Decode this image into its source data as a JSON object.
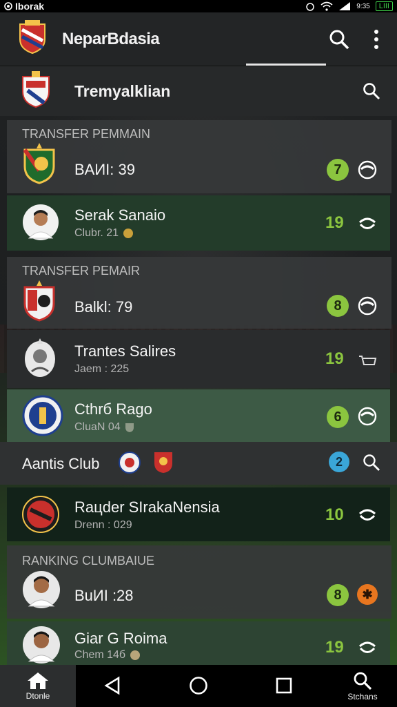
{
  "status_bar": {
    "carrier": "Iborak",
    "battery": "LIII",
    "time_glyph": "9:35"
  },
  "app_bar": {
    "title": "NeparBdasia"
  },
  "sub_bar": {
    "title": "Tremyalklian"
  },
  "sections": [
    {
      "label": "TRANSFER PEMMAIN"
    },
    {
      "label": "TRANSFER PEMAIR"
    },
    {
      "label": "RANKING CLUMBAIUE"
    }
  ],
  "rows": [
    {
      "name": "BAИI: 39",
      "sub": "",
      "value": "7",
      "value_style": "badge"
    },
    {
      "name": "Serak Sanaio",
      "sub": "Clubr. 21",
      "value": "19",
      "value_style": "score"
    },
    {
      "name": "Balkl: 79",
      "sub": "",
      "value": "8",
      "value_style": "badge"
    },
    {
      "name": "Trantes Salires",
      "sub": "Jaem : 225",
      "value": "19",
      "value_style": "score"
    },
    {
      "name": "Cthrб Rago",
      "sub": "CluaN 04",
      "value": "6",
      "value_style": "badge"
    },
    {
      "name": "Aantis Club",
      "sub": "",
      "value": "2",
      "value_style": "blue"
    },
    {
      "name": "Raцder SIrakaNensia",
      "sub": "Drenn : 029",
      "value": "10",
      "value_style": "score"
    },
    {
      "name": "BuИI :28",
      "sub": "",
      "value": "8",
      "value_style": "badge"
    },
    {
      "name": "Giar G Roima",
      "sub": "Chem 14б",
      "value": "19",
      "value_style": "score"
    }
  ],
  "nav": {
    "home_label": "Dtonle",
    "search_label": "Stchans"
  },
  "colors": {
    "accent_green": "#8bc53f",
    "orange": "#e8761f",
    "blue_badge": "#3aa6d8"
  }
}
